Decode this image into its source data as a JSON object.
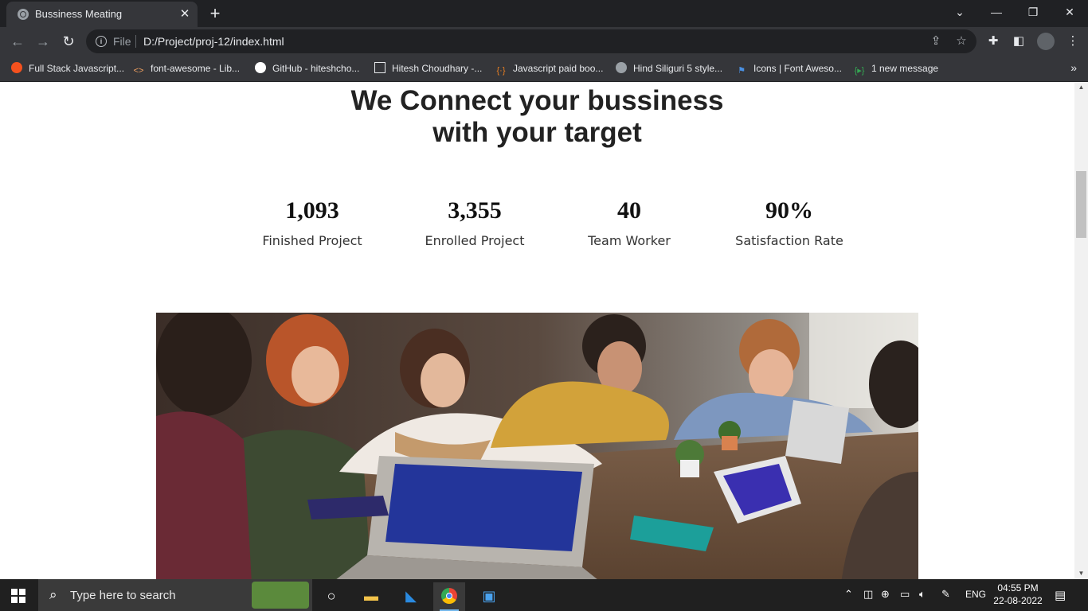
{
  "browser": {
    "tab_title": "Bussiness Meating",
    "scheme_label": "File",
    "url": "D:/Project/proj-12/index.html",
    "bookmarks": [
      {
        "label": "Full Stack Javascript...",
        "icon": "orange-circle-icon"
      },
      {
        "label": "font-awesome - Lib...",
        "icon": "code-brackets-icon"
      },
      {
        "label": "GitHub - hiteshcho...",
        "icon": "github-icon"
      },
      {
        "label": "Hitesh Choudhary -...",
        "icon": "page-icon"
      },
      {
        "label": "Javascript paid boo...",
        "icon": "braces-icon"
      },
      {
        "label": "Hind Siliguri 5 style...",
        "icon": "globe-icon"
      },
      {
        "label": "Icons | Font Aweso...",
        "icon": "flag-icon"
      },
      {
        "label": "1 new message",
        "icon": "chat-icon"
      }
    ]
  },
  "page": {
    "headline_line1": "We Connect your bussiness",
    "headline_line2": "with your target",
    "stats": [
      {
        "value": "1,093",
        "label": "Finished Project"
      },
      {
        "value": "3,355",
        "label": "Enrolled Project"
      },
      {
        "value": "40",
        "label": "Team Worker"
      },
      {
        "value": "90%",
        "label": "Satisfaction Rate"
      }
    ]
  },
  "taskbar": {
    "search_placeholder": "Type here to search",
    "language": "ENG",
    "time": "04:55 PM",
    "date": "22-08-2022"
  }
}
